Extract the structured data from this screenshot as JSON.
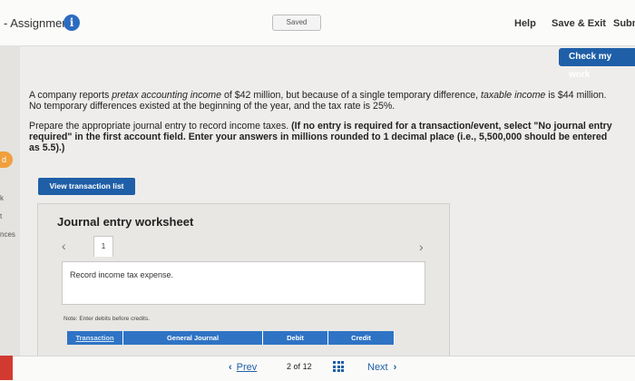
{
  "header": {
    "assignment_label": "- Assignment",
    "info_icon_glyph": "i",
    "saved_label": "Saved",
    "help_label": "Help",
    "save_exit_label": "Save & Exit",
    "submit_label": "Subm"
  },
  "left_edge": {
    "badge": "d",
    "edge_text_1": "k",
    "edge_text_2": "t",
    "edge_text_3": "nces"
  },
  "check_work_label": "Check my work",
  "question": {
    "p1_a": "A company reports ",
    "p1_term1": "pretax accounting income",
    "p1_b": " of $42 million, but because of a single temporary difference, ",
    "p1_term2": "taxable income",
    "p1_c": " is $44 million. No temporary differences existed at the beginning of the year, and the tax rate is 25%.",
    "p2_a": "Prepare the appropriate journal entry to record income taxes. ",
    "p2_bold": "(If no entry is required for a transaction/event, select \"No journal entry required\" in the first account field. Enter your answers in millions rounded to 1 decimal place (i.e., 5,500,000 should be entered as 5.5).)"
  },
  "view_transaction_label": "View transaction list",
  "worksheet": {
    "title": "Journal entry worksheet",
    "tab_label": "1",
    "description": "Record income tax expense.",
    "note": "Note: Enter debits before credits.",
    "columns": [
      "Transaction",
      "General Journal",
      "Debit",
      "Credit"
    ]
  },
  "footer": {
    "prev_label": "Prev",
    "page_current": "2",
    "page_of": "of",
    "page_total": "12",
    "next_label": "Next"
  },
  "colors": {
    "primary": "#1f5fa8",
    "table_header": "#2f73c4",
    "badge_orange": "#f0a03c",
    "red_strip": "#d23a30"
  }
}
